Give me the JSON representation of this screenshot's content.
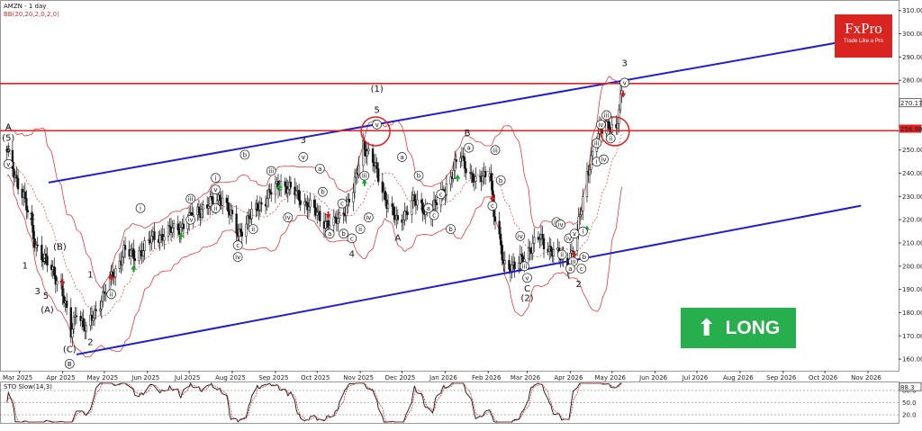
{
  "header": {
    "ticker": "AMZN - 1 day",
    "bb": "BB(20,20,2,0,2,0)",
    "sto": "STO Slow(14,3)"
  },
  "brand": {
    "name": "FxPro",
    "tagline": "Trade Like a Pro"
  },
  "badge": {
    "label": "LONG",
    "icon": "up-arrow-icon"
  },
  "colors": {
    "channel": "#1f1fcc",
    "resistance": "#e02020",
    "bands": "#e23a3a",
    "candle": "#111111",
    "signal_up": "#1fa32e",
    "signal_down": "#cc1f1f",
    "badge": "#27ae4d",
    "brand": "#d9241f"
  },
  "chart_data": {
    "type": "candlestick",
    "x_ticks": [
      "Mar 2025",
      "Apr 2025",
      "May 2025",
      "Jun 2025",
      "Jul 2025",
      "Aug 2025",
      "Sep 2025",
      "Oct 2025",
      "Nov 2025",
      "Dec 2025",
      "Jan 2026",
      "Feb 2026",
      "Mar 2026",
      "Apr 2026",
      "May 2026",
      "Jun 2026",
      "Jul 2026",
      "Aug 2026",
      "Sep 2026",
      "Oct 2026",
      "Nov 2026"
    ],
    "y_ticks": [
      160,
      170,
      180,
      190,
      200,
      210,
      220,
      230,
      240,
      250,
      260,
      270,
      280,
      290,
      300,
      310
    ],
    "ylim": [
      155,
      313
    ],
    "price_labels": [
      "270.17",
      "258.98"
    ],
    "price_path": [
      {
        "d": "2025-02-20",
        "p": 248
      },
      {
        "d": "2025-03-04",
        "p": 230
      },
      {
        "d": "2025-03-11",
        "p": 212
      },
      {
        "d": "2025-03-17",
        "p": 205
      },
      {
        "d": "2025-03-24",
        "p": 198
      },
      {
        "d": "2025-03-31",
        "p": 192
      },
      {
        "d": "2025-04-07",
        "p": 170
      },
      {
        "d": "2025-04-11",
        "p": 182
      },
      {
        "d": "2025-04-18",
        "p": 172
      },
      {
        "d": "2025-04-28",
        "p": 185
      },
      {
        "d": "2025-05-09",
        "p": 198
      },
      {
        "d": "2025-05-15",
        "p": 207
      },
      {
        "d": "2025-05-22",
        "p": 204
      },
      {
        "d": "2025-06-05",
        "p": 212
      },
      {
        "d": "2025-06-25",
        "p": 217
      },
      {
        "d": "2025-07-10",
        "p": 225
      },
      {
        "d": "2025-07-25",
        "p": 230
      },
      {
        "d": "2025-08-05",
        "p": 214
      },
      {
        "d": "2025-08-20",
        "p": 226
      },
      {
        "d": "2025-09-05",
        "p": 236
      },
      {
        "d": "2025-09-18",
        "p": 230
      },
      {
        "d": "2025-10-05",
        "p": 220
      },
      {
        "d": "2025-10-12",
        "p": 217
      },
      {
        "d": "2025-10-20",
        "p": 224
      },
      {
        "d": "2025-10-27",
        "p": 232
      },
      {
        "d": "2025-11-03",
        "p": 253
      },
      {
        "d": "2025-11-10",
        "p": 245
      },
      {
        "d": "2025-11-20",
        "p": 228
      },
      {
        "d": "2025-11-28",
        "p": 218
      },
      {
        "d": "2025-12-08",
        "p": 228
      },
      {
        "d": "2025-12-22",
        "p": 223
      },
      {
        "d": "2026-01-05",
        "p": 238
      },
      {
        "d": "2026-01-12",
        "p": 248
      },
      {
        "d": "2026-01-23",
        "p": 235
      },
      {
        "d": "2026-02-02",
        "p": 243
      },
      {
        "d": "2026-02-05",
        "p": 222
      },
      {
        "d": "2026-02-12",
        "p": 202
      },
      {
        "d": "2026-02-20",
        "p": 199
      },
      {
        "d": "2026-03-02",
        "p": 207
      },
      {
        "d": "2026-03-10",
        "p": 212
      },
      {
        "d": "2026-03-20",
        "p": 206
      },
      {
        "d": "2026-03-30",
        "p": 201
      },
      {
        "d": "2026-04-06",
        "p": 214
      },
      {
        "d": "2026-04-13",
        "p": 240
      },
      {
        "d": "2026-04-20",
        "p": 255
      },
      {
        "d": "2026-04-27",
        "p": 262
      },
      {
        "d": "2026-05-04",
        "p": 258
      },
      {
        "d": "2026-05-08",
        "p": 275
      }
    ],
    "bollinger_band_width": 26,
    "stochastic_levels": [
      80,
      50,
      20
    ],
    "stochastic_current": 88.3,
    "channel_upper": [
      {
        "d": "2025-03-22",
        "p": 236
      },
      {
        "d": "2026-10-27",
        "p": 298
      }
    ],
    "channel_lower": [
      {
        "d": "2025-04-11",
        "p": 162
      },
      {
        "d": "2026-10-27",
        "p": 226
      }
    ],
    "resistance_levels": [
      278.6,
      258.3
    ],
    "wave_labels": [
      {
        "t": "A",
        "d": "2025-02-21",
        "p": 258.5,
        "s": "big"
      },
      {
        "t": "(5)",
        "d": "2025-02-21",
        "p": 254,
        "s": "big"
      },
      {
        "t": "5",
        "d": "2025-02-21",
        "p": 249,
        "s": "big"
      },
      {
        "t": "v",
        "d": "2025-02-21",
        "p": 243,
        "s": "circ"
      },
      {
        "t": "2",
        "d": "2025-03-10",
        "p": 220,
        "s": "big"
      },
      {
        "t": "1",
        "d": "2025-03-05",
        "p": 199,
        "s": "big"
      },
      {
        "t": "4",
        "d": "2025-03-19",
        "p": 201,
        "s": "big"
      },
      {
        "t": "3",
        "d": "2025-03-14",
        "p": 188,
        "s": "big"
      },
      {
        "t": "5",
        "d": "2025-03-20",
        "p": 186,
        "s": "big"
      },
      {
        "t": "(B)",
        "d": "2025-03-30",
        "p": 207,
        "s": "big"
      },
      {
        "t": "(A)",
        "d": "2025-03-21",
        "p": 180,
        "s": "big"
      },
      {
        "t": "(C)",
        "d": "2025-04-06",
        "p": 163,
        "s": "big"
      },
      {
        "t": "2",
        "d": "2025-04-21",
        "p": 166,
        "s": "big"
      },
      {
        "t": "1",
        "d": "2025-04-21",
        "p": 195,
        "s": "big"
      },
      {
        "t": "B",
        "d": "2025-04-06",
        "p": 157,
        "s": "circ"
      },
      {
        "t": "i",
        "d": "2025-05-27",
        "p": 224,
        "s": "circ"
      },
      {
        "t": "ii",
        "d": "2025-05-06",
        "p": 187,
        "s": "circ"
      },
      {
        "t": "iii",
        "d": "2025-07-02",
        "p": 228,
        "s": "circ"
      },
      {
        "t": "iv",
        "d": "2025-07-02",
        "p": 219,
        "s": "circ"
      },
      {
        "t": "v",
        "d": "2025-07-20",
        "p": 232,
        "s": "circ"
      },
      {
        "t": "i",
        "d": "2025-07-20",
        "p": 237,
        "s": "circ"
      },
      {
        "t": "ii",
        "d": "2025-07-20",
        "p": 224,
        "s": "circ"
      },
      {
        "t": "b",
        "d": "2025-08-10",
        "p": 247,
        "s": "circ"
      },
      {
        "t": "c",
        "d": "2025-08-05",
        "p": 208,
        "s": "circ"
      },
      {
        "t": "iv",
        "d": "2025-08-05",
        "p": 203,
        "s": "circ"
      },
      {
        "t": "ii",
        "d": "2025-08-16",
        "p": 215,
        "s": "circ"
      },
      {
        "t": "iii",
        "d": "2025-08-29",
        "p": 240,
        "s": "circ"
      },
      {
        "t": "iv",
        "d": "2025-09-10",
        "p": 220,
        "s": "circ"
      },
      {
        "t": "3",
        "d": "2025-09-21",
        "p": 253,
        "s": "big"
      },
      {
        "t": "v",
        "d": "2025-09-21",
        "p": 246,
        "s": "circ"
      },
      {
        "t": "a",
        "d": "2025-10-03",
        "p": 241,
        "s": "circ"
      },
      {
        "t": "b",
        "d": "2025-10-05",
        "p": 231,
        "s": "circ"
      },
      {
        "t": "a",
        "d": "2025-10-10",
        "p": 213,
        "s": "circ"
      },
      {
        "t": "c",
        "d": "2025-10-19",
        "p": 226,
        "s": "circ"
      },
      {
        "t": "b",
        "d": "2025-10-20",
        "p": 213,
        "s": "circ"
      },
      {
        "t": "c",
        "d": "2025-10-26",
        "p": 211,
        "s": "circ"
      },
      {
        "t": "4",
        "d": "2025-10-26",
        "p": 204,
        "s": "big"
      },
      {
        "t": "ii",
        "d": "2025-11-01",
        "p": 215,
        "s": "circ"
      },
      {
        "t": "iii",
        "d": "2025-11-04",
        "p": 238,
        "s": "circ"
      },
      {
        "t": "iv",
        "d": "2025-11-07",
        "p": 220,
        "s": "circ"
      },
      {
        "t": "(1)",
        "d": "2025-11-13",
        "p": 275,
        "s": "big"
      },
      {
        "t": "5",
        "d": "2025-11-13",
        "p": 266,
        "s": "big"
      },
      {
        "t": "v",
        "d": "2025-11-13",
        "p": 260,
        "s": "circ"
      },
      {
        "t": "a",
        "d": "2025-12-01",
        "p": 246,
        "s": "circ"
      },
      {
        "t": "b",
        "d": "2025-12-13",
        "p": 238,
        "s": "circ"
      },
      {
        "t": "c",
        "d": "2025-12-29",
        "p": 230,
        "s": "circ"
      },
      {
        "t": "A",
        "d": "2025-11-28",
        "p": 211,
        "s": "big"
      },
      {
        "t": "a",
        "d": "2025-12-20",
        "p": 224,
        "s": "circ"
      },
      {
        "t": "b",
        "d": "2026-01-05",
        "p": 215,
        "s": "circ"
      },
      {
        "t": "c",
        "d": "2025-12-24",
        "p": 221,
        "s": "circ"
      },
      {
        "t": "B",
        "d": "2026-01-17",
        "p": 256,
        "s": "big"
      },
      {
        "t": "a",
        "d": "2026-01-18",
        "p": 250,
        "s": "circ"
      },
      {
        "t": "iii",
        "d": "2026-02-06",
        "p": 249,
        "s": "circ"
      },
      {
        "t": "b",
        "d": "2026-02-10",
        "p": 236,
        "s": "circ"
      },
      {
        "t": "c",
        "d": "2026-02-04",
        "p": 225,
        "s": "circ"
      },
      {
        "t": "iv",
        "d": "2026-02-24",
        "p": 212,
        "s": "circ"
      },
      {
        "t": "iii",
        "d": "2026-02-27",
        "p": 199,
        "s": "circ"
      },
      {
        "t": "v",
        "d": "2026-03-01",
        "p": 194,
        "s": "circ"
      },
      {
        "t": "C",
        "d": "2026-03-01",
        "p": 189,
        "s": "big"
      },
      {
        "t": "(2)",
        "d": "2026-03-01",
        "p": 185,
        "s": "big"
      },
      {
        "t": "iii",
        "d": "2026-03-22",
        "p": 218,
        "s": "circ"
      },
      {
        "t": "iv",
        "d": "2026-03-25",
        "p": 217,
        "s": "circ"
      },
      {
        "t": "ii",
        "d": "2026-03-26",
        "p": 204,
        "s": "circ"
      },
      {
        "t": "iv",
        "d": "2026-03-31",
        "p": 211,
        "s": "circ"
      },
      {
        "t": "v",
        "d": "2026-04-04",
        "p": 213,
        "s": "circ"
      },
      {
        "t": "i",
        "d": "2026-04-10",
        "p": 214,
        "s": "circ"
      },
      {
        "t": "iii",
        "d": "2026-04-03",
        "p": 201,
        "s": "circ"
      },
      {
        "t": "a",
        "d": "2026-04-01",
        "p": 198,
        "s": "circ"
      },
      {
        "t": "c",
        "d": "2026-04-09",
        "p": 198,
        "s": "circ"
      },
      {
        "t": "b",
        "d": "2026-04-11",
        "p": 203,
        "s": "circ"
      },
      {
        "t": "2",
        "d": "2026-04-07",
        "p": 191,
        "s": "big"
      },
      {
        "t": "iii",
        "d": "2026-04-20",
        "p": 252,
        "s": "circ"
      },
      {
        "t": "iv",
        "d": "2026-04-23",
        "p": 260,
        "s": "circ"
      },
      {
        "t": "i",
        "d": "2026-04-20",
        "p": 244,
        "s": "circ"
      },
      {
        "t": "iv",
        "d": "2026-04-25",
        "p": 245,
        "s": "circ"
      },
      {
        "t": "ii",
        "d": "2026-04-30",
        "p": 254,
        "s": "circ"
      },
      {
        "t": "iii",
        "d": "2026-04-27",
        "p": 264,
        "s": "circ"
      },
      {
        "t": "3",
        "d": "2026-05-10",
        "p": 286,
        "s": "big"
      },
      {
        "t": "v",
        "d": "2026-05-10",
        "p": 278,
        "s": "circ"
      }
    ],
    "signal_arrows": [
      {
        "d": "2025-04-01",
        "p": 193,
        "dir": "down"
      },
      {
        "d": "2025-05-06",
        "p": 195,
        "dir": "down"
      },
      {
        "d": "2025-05-22",
        "p": 199,
        "dir": "up"
      },
      {
        "d": "2025-06-25",
        "p": 213,
        "dir": "up"
      },
      {
        "d": "2025-07-20",
        "p": 224,
        "dir": "up"
      },
      {
        "d": "2025-09-04",
        "p": 234,
        "dir": "up"
      },
      {
        "d": "2025-10-09",
        "p": 222,
        "dir": "down"
      },
      {
        "d": "2025-11-04",
        "p": 236,
        "dir": "up"
      },
      {
        "d": "2026-01-10",
        "p": 238,
        "dir": "up"
      },
      {
        "d": "2026-02-04",
        "p": 229,
        "dir": "down"
      },
      {
        "d": "2026-04-04",
        "p": 205,
        "dir": "down"
      },
      {
        "d": "2026-04-13",
        "p": 216,
        "dir": "up"
      },
      {
        "d": "2026-05-09",
        "p": 274,
        "dir": "down"
      }
    ],
    "circles": [
      {
        "d": "2025-11-12",
        "p": 258,
        "r": 16
      },
      {
        "d": "2026-05-03",
        "p": 258,
        "r": 16
      }
    ]
  }
}
